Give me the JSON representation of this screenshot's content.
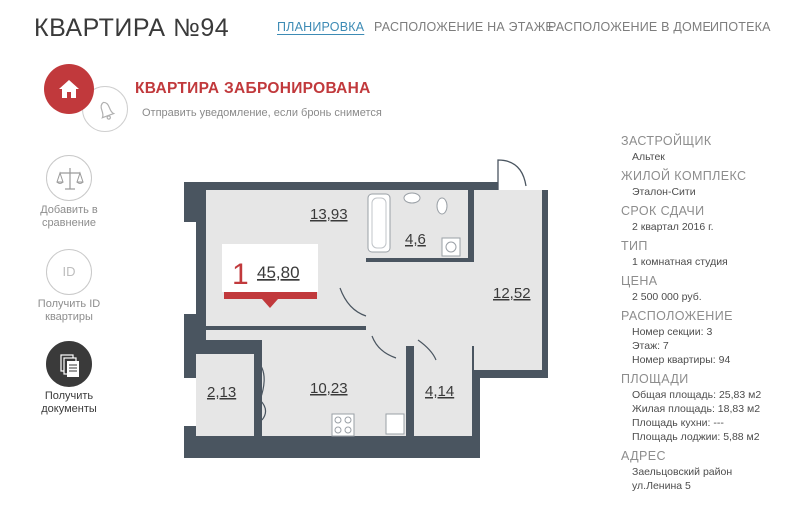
{
  "header": {
    "title": "КВАРТИРА №94",
    "nav": [
      "ПЛАНИРОВКА",
      "РАСПОЛОЖЕНИЕ НА ЭТАЖЕ",
      "РАСПОЛОЖЕНИЕ В ДОМЕ",
      "ИПОТЕКА"
    ],
    "active_tab": "ПЛАНИРОВКА"
  },
  "status": {
    "title": "КВАРТИРА ЗАБРОНИРОВАНА",
    "notify_text": "Отправить уведомление, если бронь снимется",
    "house_icon": "house-icon",
    "bell_icon": "bell-icon"
  },
  "sidebar": {
    "compare_label": "Добавить в сравнение",
    "id_icon_text": "ID",
    "id_label": "Получить ID квартиры",
    "docs_label": "Получить документы"
  },
  "plan": {
    "rooms_count": "1",
    "total_area": "45,80",
    "rooms": [
      "13,93",
      "4,6",
      "12,52",
      "2,13",
      "10,23",
      "4,14"
    ]
  },
  "details": {
    "developer_label": "ЗАСТРОЙЩИК",
    "developer": "Альтек",
    "complex_label": "ЖИЛОЙ КОМПЛЕКС",
    "complex": "Эталон-Сити",
    "deadline_label": "СРОК СДАЧИ",
    "deadline": "2 квартал 2016 г.",
    "type_label": "ТИП",
    "type": "1 комнатная студия",
    "price_label": "ЦЕНА",
    "price": "2 500 000 руб.",
    "location_label": "РАСПОЛОЖЕНИЕ",
    "section": "Номер секции: 3",
    "floor": "Этаж: 7",
    "apartment_number": "Номер квартиры: 94",
    "areas_label": "ПЛОЩАДИ",
    "total_area": "Общая площадь: 25,83 м2",
    "living_area": "Жилая площадь: 18,83 м2",
    "kitchen_area": "Площадь кухни: ---",
    "loggia_area": "Площадь лоджии: 5,88 м2",
    "address_label": "АДРЕС",
    "district": "Заельцовский район",
    "street": "ул.Ленина 5"
  },
  "colors": {
    "accent": "#c1393c",
    "link": "#3d8bb5",
    "wall": "#4a5560",
    "room": "#e6e6e6"
  }
}
